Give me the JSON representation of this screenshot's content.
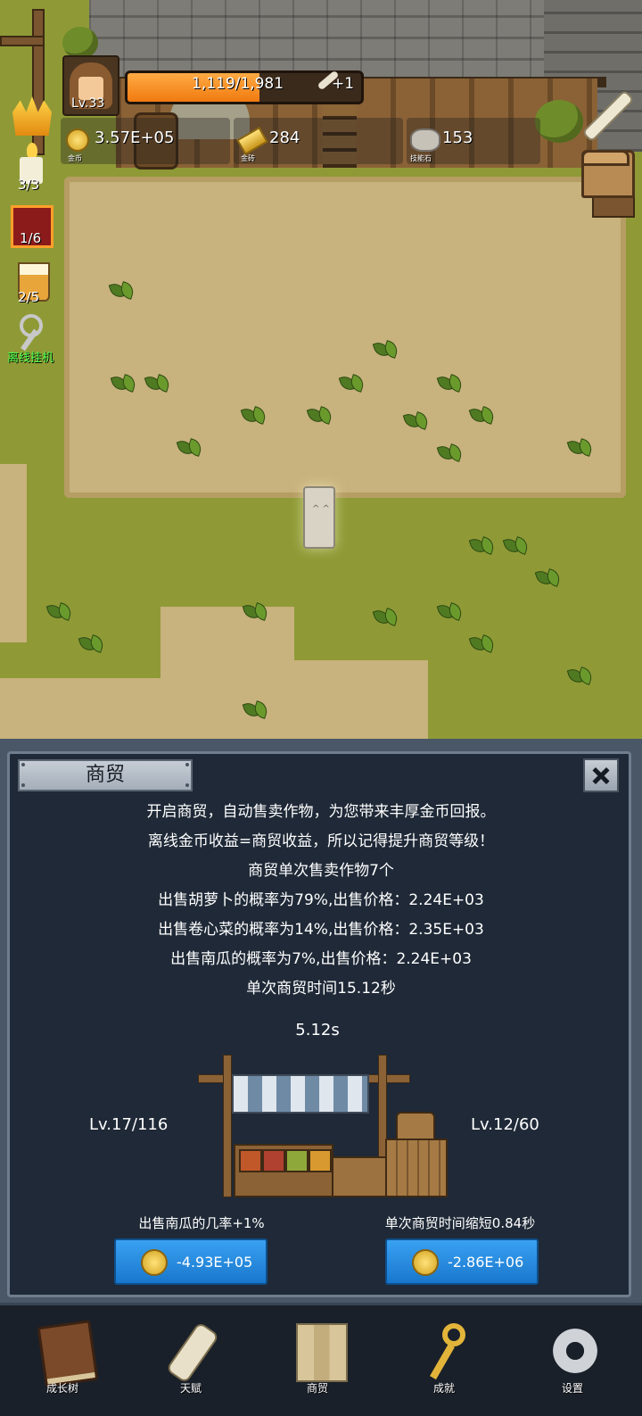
{
  "hud": {
    "player_level": "Lv.33",
    "xp_text": "1,119/1,981",
    "xp_fraction": 0.565,
    "xp_bonus": "+1",
    "resources": [
      {
        "icon": "gold-coin-icon",
        "value": "3.57E+05",
        "label": "金币"
      },
      {
        "icon": "gold-bar-icon",
        "value": "284",
        "label": "金砖"
      },
      {
        "icon": "skill-stone-icon",
        "value": "153",
        "label": "技能石"
      }
    ],
    "side": {
      "candle_count": "3/3",
      "cube_count": "1/6",
      "drink_count": "2/5",
      "auto_play_label": "离线挂机"
    }
  },
  "panel": {
    "title": "商贸",
    "lines": [
      "开启商贸，自动售卖作物，为您带来丰厚金币回报。",
      "离线金币收益=商贸收益，所以记得提升商贸等级！",
      "商贸单次售卖作物7个",
      "出售胡萝卜的概率为79%,出售价格：2.24E+03",
      "出售卷心菜的概率为14%,出售价格：2.35E+03",
      "出售南瓜的概率为7%,出售价格：2.24E+03",
      "单次商贸时间15.12秒"
    ],
    "timer": "5.12s",
    "left_upgrade": {
      "level": "Lv.17/116",
      "description": "出售南瓜的几率+1%",
      "cost": "-4.93E+05"
    },
    "right_upgrade": {
      "level": "Lv.12/60",
      "description": "单次商贸时间缩短0.84秒",
      "cost": "-2.86E+06"
    }
  },
  "nav": [
    {
      "label": "成长树",
      "icon": "book-icon"
    },
    {
      "label": "天赋",
      "icon": "scroll-icon"
    },
    {
      "label": "商贸",
      "icon": "map-icon"
    },
    {
      "label": "成就",
      "icon": "key-icon"
    },
    {
      "label": "设置",
      "icon": "gear-icon"
    }
  ],
  "colors": {
    "xp_fill": "#f07a10",
    "buy_button": "#1877cc",
    "panel_bg": "#1f2937",
    "auto_play_text": "#4fff4f"
  }
}
